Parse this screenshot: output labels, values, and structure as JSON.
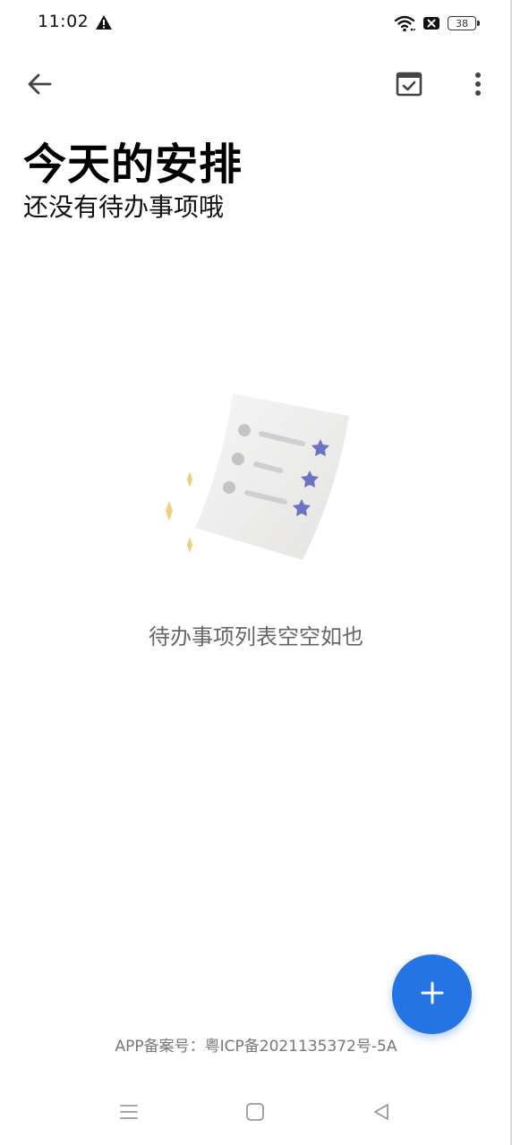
{
  "status_bar": {
    "time": "11:02",
    "battery_level": "38",
    "icons": [
      "alert-icon",
      "wifi-icon",
      "sim-off-icon",
      "battery-icon"
    ]
  },
  "toolbar": {
    "back_icon": "arrow-left-icon",
    "calendar_icon": "calendar-check-icon",
    "more_icon": "more-vertical-icon"
  },
  "header": {
    "title": "今天的安排",
    "subtitle": "还没有待办事项哦"
  },
  "empty_state": {
    "illustration": "todo-list-illustration",
    "message": "待办事项列表空空如也"
  },
  "fab": {
    "icon": "plus-icon",
    "color": "#2474e5"
  },
  "footer": {
    "icp": "APP备案号：粤ICP备2021135372号-5A"
  },
  "nav_bar": {
    "icons": [
      "menu-icon",
      "home-square-icon",
      "back-triangle-icon"
    ]
  },
  "colors": {
    "accent": "#2474e5",
    "star": "#6b74c4",
    "sparkle": "#f3cf7a"
  }
}
